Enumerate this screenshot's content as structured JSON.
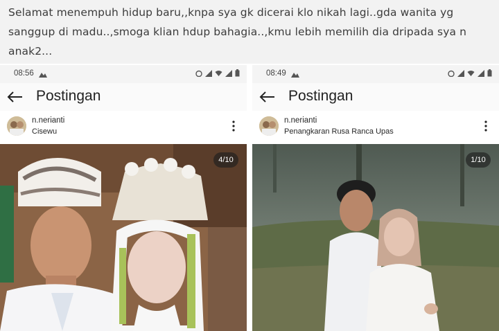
{
  "caption": {
    "text": "Selamat menempuh hidup baru,,knpa sya gk dicerai klo nikah lagi..gda wanita yg sanggup di madu..,smoga klian hdup bahagia..,kmu lebih memilih dia dripada sya n anak2..."
  },
  "screens": [
    {
      "status_time": "08:56",
      "app_title": "Postingan",
      "username": "n.nerianti",
      "location": "Cisewu",
      "photo_counter": "4/10",
      "photo_icon": "wedding-photo",
      "back_icon": "arrow-left-icon",
      "more_icon": "more-vert-icon"
    },
    {
      "status_time": "08:49",
      "app_title": "Postingan",
      "username": "n.nerianti",
      "location": "Penangkaran Rusa Ranca Upas",
      "photo_counter": "1/10",
      "photo_icon": "prewedding-photo",
      "back_icon": "arrow-left-icon",
      "more_icon": "more-vert-icon"
    }
  ],
  "colors": {
    "caption_bg": "#f2f2f2",
    "statusbar_bg": "#f4f4f4",
    "text": "#262626"
  }
}
